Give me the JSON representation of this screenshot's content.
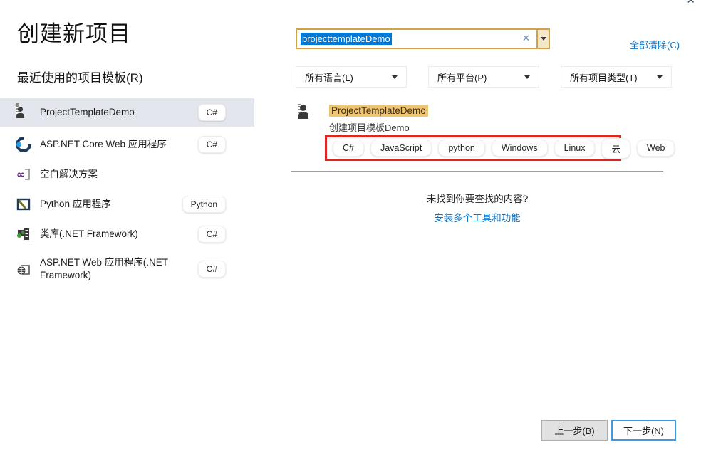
{
  "window": {
    "close_glyph": "✕"
  },
  "header": {
    "title": "创建新项目"
  },
  "sidebar": {
    "heading": "最近使用的项目模板(R)",
    "items": [
      {
        "label": "ProjectTemplateDemo",
        "badge": "C#",
        "icon": "project-template",
        "selected": true
      },
      {
        "label": "ASP.NET Core Web 应用程序",
        "badge": "C#",
        "icon": "aspnet-core"
      },
      {
        "label": "空白解决方案",
        "badge": "",
        "icon": "blank-solution"
      },
      {
        "label": "Python 应用程序",
        "badge": "Python",
        "icon": "python-app"
      },
      {
        "label": "类库(.NET Framework)",
        "badge": "C#",
        "icon": "class-library"
      },
      {
        "label": "ASP.NET Web 应用程序(.NET Framework)",
        "badge": "C#",
        "icon": "aspnet-web"
      }
    ]
  },
  "search": {
    "value": "projecttemplateDemo",
    "clear_glyph": "✕",
    "clear_all_label": "全部清除(C)"
  },
  "filters": [
    {
      "label": "所有语言(L)"
    },
    {
      "label": "所有平台(P)"
    },
    {
      "label": "所有项目类型(T)"
    }
  ],
  "results": {
    "template": {
      "title": "ProjectTemplateDemo",
      "description": "创建项目模板Demo",
      "tags": [
        "C#",
        "JavaScript",
        "python",
        "Windows",
        "Linux",
        "云",
        "Web"
      ]
    },
    "not_found": {
      "message": "未找到你要查找的内容?",
      "link_label": "安装多个工具和功能"
    }
  },
  "footer": {
    "back_label": "上一步(B)",
    "next_label": "下一步(N)"
  },
  "colors": {
    "selection_blue": "#0078d7",
    "link_blue": "#0974c8",
    "search_border_gold": "#cfa349",
    "highlight_tan": "#efc573",
    "annotation_red": "#e32222",
    "selected_row": "#e4e6ed"
  }
}
